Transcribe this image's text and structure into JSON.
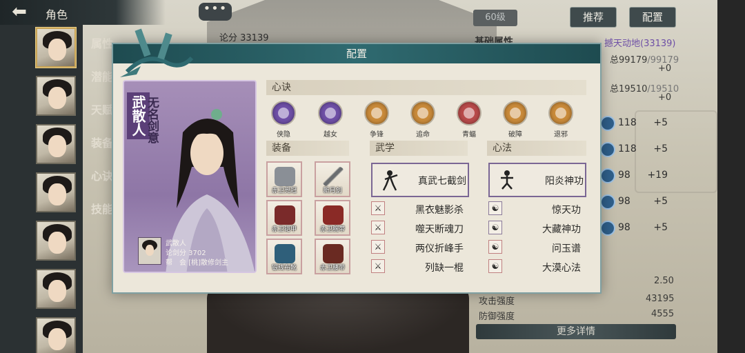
{
  "header": {
    "title": "角色",
    "back_icon": "arrow-left-icon"
  },
  "chat": {
    "label": "•••"
  },
  "sidebar": {
    "menu": [
      "属性",
      "潜能",
      "天赋",
      "装备",
      "心诀",
      "技能"
    ]
  },
  "right_panel": {
    "level": "60级",
    "recommend_label": "推荐",
    "config_label": "配置",
    "basic_attr_title": "基础属性",
    "score_strip": "论分 33139",
    "power_label": "撼天动地(33139)",
    "hp_total": "总99179",
    "hp_max": "/99179",
    "hp_bonus": "+0",
    "mp_total": "总19510",
    "mp_max": "/19510",
    "mp_bonus": "+0",
    "stats": [
      {
        "value": "118",
        "bonus": "+5"
      },
      {
        "value": "118",
        "bonus": "+5"
      },
      {
        "value": "98",
        "bonus": "+19"
      },
      {
        "value": "98",
        "bonus": "+5"
      },
      {
        "value": "98",
        "bonus": "+5"
      }
    ],
    "value_250": "2.50",
    "attack_label": "攻击强度",
    "attack_value": "43195",
    "defense_label": "防御强度",
    "defense_value": "4555",
    "more_label": "更多详情"
  },
  "modal": {
    "title": "配置",
    "card": {
      "vertical_a": "武散人",
      "vertical_b": "无名剑意",
      "name_line": "武散人",
      "score_line": "论剑分 3702",
      "guild_line": "帮　会 [桃]散修剑主"
    },
    "xinjue_title": "心诀",
    "skills": [
      "侠隐",
      "越女",
      "争锋",
      "追命",
      "青蝠",
      "破障",
      "退邪"
    ],
    "skill_colors": [
      "#6e4fa6",
      "#6e4fa6",
      "#c98a3a",
      "#c98a3a",
      "#b84a4a",
      "#c98a3a",
      "#c98a3a"
    ],
    "equip_title": "装备",
    "equipment": [
      "赤卫兜冠",
      "新月剑",
      "赤卫铠甲",
      "赤卫腕带",
      "银线布靴",
      "赤卫腰带"
    ],
    "wuxue_title": "武学",
    "wuxue_main": "真武七截剑",
    "wuxue_list": [
      "黑衣魅影杀",
      "噬天断魂刀",
      "两仪折峰手",
      "列缺一棍"
    ],
    "xinfa_title": "心法",
    "xinfa_main": "阳炎神功",
    "xinfa_list": [
      "惊天功",
      "大藏神功",
      "问玉谱",
      "大漠心法"
    ]
  }
}
